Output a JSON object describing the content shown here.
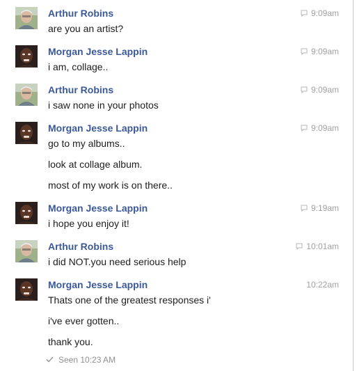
{
  "conversation": {
    "messages": [
      {
        "sender": "Arthur Robins",
        "avatar": "arthur",
        "time": "9:09am",
        "icon": "message-icon",
        "lines": [
          "are you an artist?"
        ]
      },
      {
        "sender": "Morgan Jesse Lappin",
        "avatar": "morgan",
        "time": "9:09am",
        "icon": "message-icon",
        "lines": [
          "i am, collage.."
        ]
      },
      {
        "sender": "Arthur Robins",
        "avatar": "arthur",
        "time": "9:09am",
        "icon": "message-icon",
        "lines": [
          "i saw none in your photos"
        ]
      },
      {
        "sender": "Morgan Jesse Lappin",
        "avatar": "morgan",
        "time": "9:09am",
        "icon": "message-icon",
        "lines": [
          "go to my albums..",
          "look at collage album.",
          "most of my work is on there.."
        ]
      },
      {
        "sender": "Morgan Jesse Lappin",
        "avatar": "morgan",
        "time": "9:19am",
        "icon": "message-icon",
        "lines": [
          "i hope you enjoy it!"
        ]
      },
      {
        "sender": "Arthur Robins",
        "avatar": "arthur",
        "time": "10:01am",
        "icon": "message-icon",
        "lines": [
          "i did NOT.you need serious help"
        ]
      },
      {
        "sender": "Morgan Jesse Lappin",
        "avatar": "morgan",
        "time": "10:22am",
        "icon": "",
        "lines": [
          "Thats one of the greatest responses i'",
          "i've ever gotten..",
          "thank you."
        ]
      }
    ],
    "seen": {
      "icon": "checkmark-icon",
      "text": "Seen 10:23 AM"
    }
  },
  "colors": {
    "sender_name": "#3b5998",
    "message_text": "#1d1d1d",
    "timestamp": "#a0a0a0",
    "seen_text": "#909090"
  }
}
